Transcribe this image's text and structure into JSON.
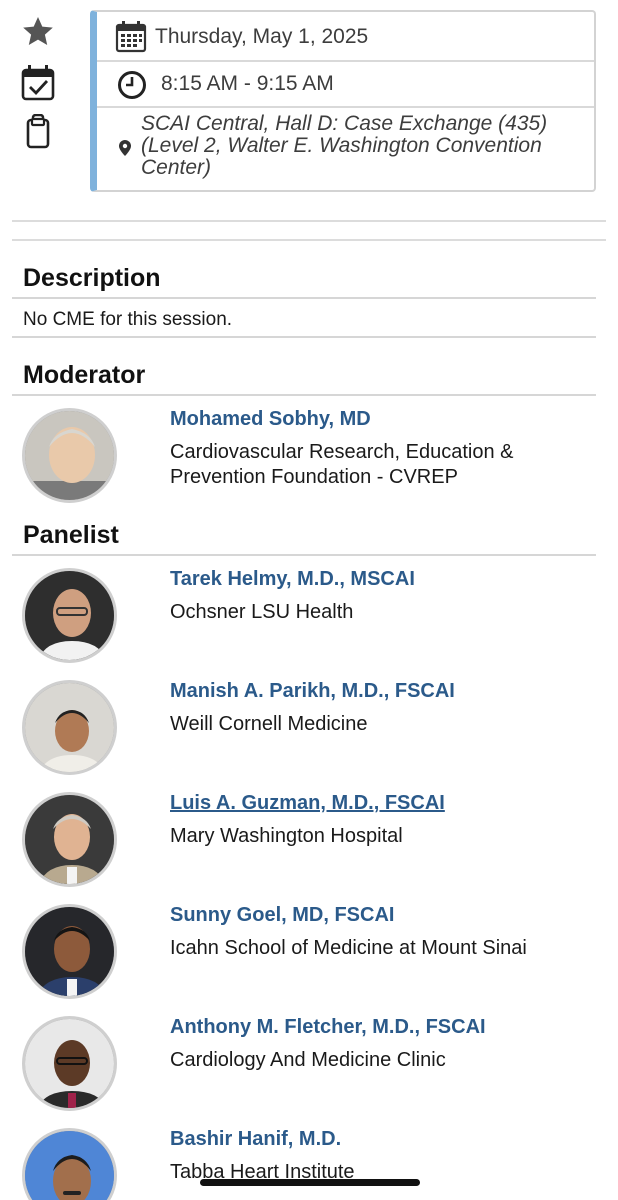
{
  "session": {
    "date": "Thursday, May 1, 2025",
    "time": "8:15 AM - 9:15 AM",
    "location": "SCAI Central, Hall D: Case Exchange (435) (Level 2, Walter E. Washington Convention Center)"
  },
  "description": {
    "title": "Description",
    "text": "No CME for this session."
  },
  "moderator": {
    "title": "Moderator",
    "people": [
      {
        "name": "Mohamed Sobhy, MD",
        "org": "Cardiovascular Research, Education & Prevention Foundation - CVREP"
      }
    ]
  },
  "panelist": {
    "title": "Panelist",
    "people": [
      {
        "name": "Tarek Helmy, M.D., MSCAI",
        "org": "Ochsner LSU Health"
      },
      {
        "name": "Manish A. Parikh, M.D., FSCAI",
        "org": "Weill Cornell Medicine"
      },
      {
        "name": "Luis A. Guzman, M.D., FSCAI",
        "org": "Mary Washington Hospital"
      },
      {
        "name": "Sunny Goel, MD, FSCAI",
        "org": "Icahn School of Medicine at Mount Sinai"
      },
      {
        "name": "Anthony M. Fletcher, M.D., FSCAI",
        "org": "Cardiology And Medicine Clinic"
      },
      {
        "name": "Bashir Hanif, M.D.",
        "org": "Tabba Heart Institute"
      }
    ]
  },
  "icons": [
    "star-icon",
    "calendar-check-icon",
    "clipboard-icon",
    "calendar-icon",
    "clock-icon",
    "location-pin-icon"
  ],
  "colors": {
    "accent_bar": "#7fb2dc",
    "link_name": "#2b5a8a",
    "icon": "#333333"
  }
}
